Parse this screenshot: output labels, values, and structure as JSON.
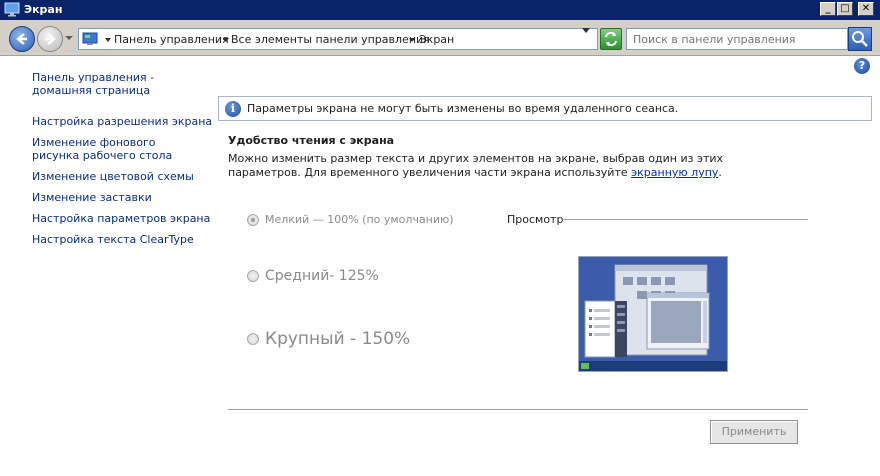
{
  "window": {
    "title": "Экран",
    "minimize": "_",
    "maximize": "□",
    "close": "✕"
  },
  "address": {
    "crumbs": [
      "Панель управления",
      "Все элементы панели управления",
      "Экран"
    ],
    "search_placeholder": "Поиск в панели управления"
  },
  "help": "?",
  "sidebar": {
    "items": [
      {
        "label": "Панель управления - домашняя страница"
      },
      {
        "label": "Настройка разрешения экрана"
      },
      {
        "label": "Изменение фонового рисунка рабочего стола"
      },
      {
        "label": "Изменение цветовой схемы"
      },
      {
        "label": "Изменение заставки"
      },
      {
        "label": "Настройка параметров экрана"
      },
      {
        "label": "Настройка текста ClearType"
      }
    ]
  },
  "info": {
    "icon": "i",
    "text": "Параметры экрана не могут быть изменены во время удаленного сеанса."
  },
  "main": {
    "title": "Удобство чтения с экрана",
    "description_before": "Можно изменить размер текста и других элементов на экране, выбрав один из этих параметров. Для временного увеличения части экрана используйте ",
    "description_link": "экранную лупу",
    "description_after": ".",
    "options": [
      {
        "label": "Мелкий — 100% (по умолчанию)",
        "checked": true
      },
      {
        "label": "Средний- 125%",
        "checked": false
      },
      {
        "label": "Крупный - 150%",
        "checked": false
      }
    ],
    "preview_label": "Просмотр",
    "apply_label": "Применить"
  }
}
